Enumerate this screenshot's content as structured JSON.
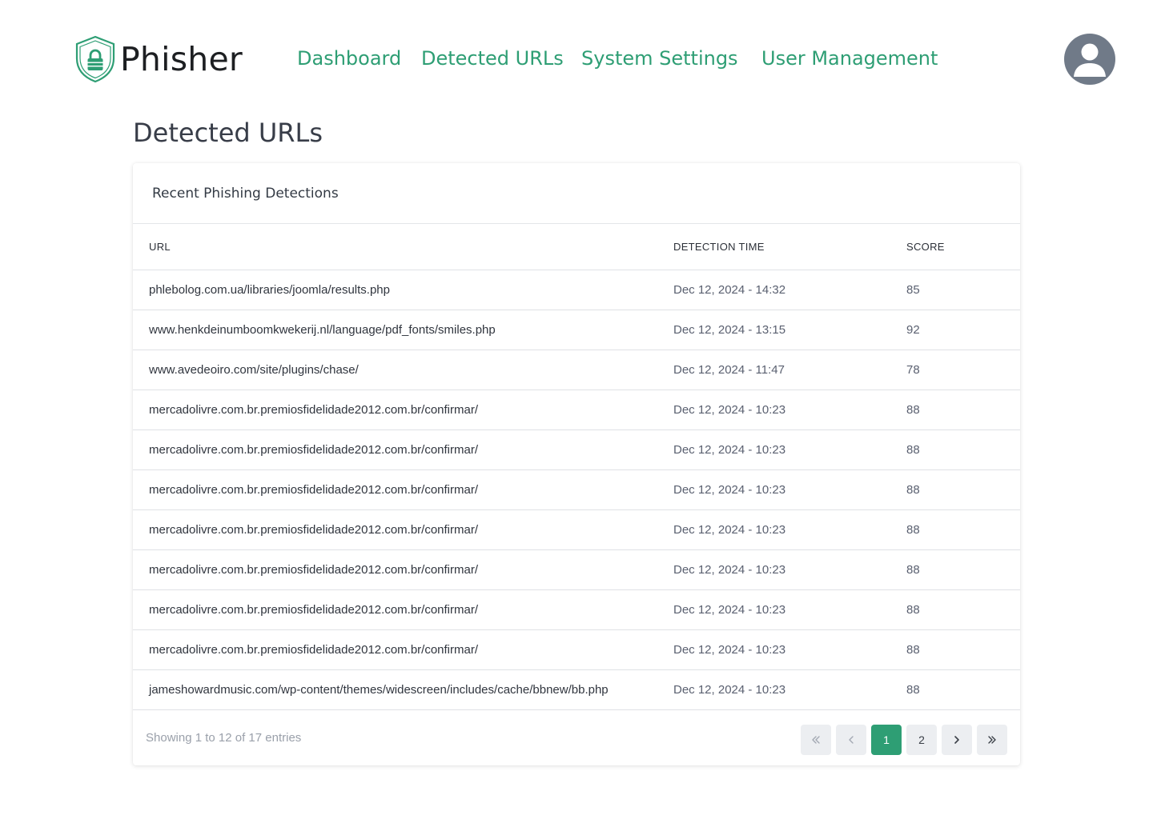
{
  "app": {
    "name": "Phisher",
    "brand_color": "#2e9e74"
  },
  "nav": {
    "items": [
      {
        "label": "Dashboard"
      },
      {
        "label": "Detected URLs"
      },
      {
        "label": "System Settings"
      },
      {
        "label": "User Management"
      }
    ]
  },
  "user": {
    "icon": "user-avatar-icon"
  },
  "page": {
    "title": "Detected URLs"
  },
  "card": {
    "title": "Recent Phishing Detections"
  },
  "table": {
    "columns": [
      "URL",
      "DETECTION TIME",
      "SCORE"
    ],
    "rows": [
      {
        "url": "phlebolog.com.ua/libraries/joomla/results.php",
        "time": "Dec 12, 2024 - 14:32",
        "score": "85"
      },
      {
        "url": "www.henkdeinumboomkwekerij.nl/language/pdf_fonts/smiles.php",
        "time": "Dec 12, 2024 - 13:15",
        "score": "92"
      },
      {
        "url": "www.avedeoiro.com/site/plugins/chase/",
        "time": "Dec 12, 2024 - 11:47",
        "score": "78"
      },
      {
        "url": "mercadolivre.com.br.premiosfidelidade2012.com.br/confirmar/",
        "time": "Dec 12, 2024 - 10:23",
        "score": "88"
      },
      {
        "url": "mercadolivre.com.br.premiosfidelidade2012.com.br/confirmar/",
        "time": "Dec 12, 2024 - 10:23",
        "score": "88"
      },
      {
        "url": "mercadolivre.com.br.premiosfidelidade2012.com.br/confirmar/",
        "time": "Dec 12, 2024 - 10:23",
        "score": "88"
      },
      {
        "url": "mercadolivre.com.br.premiosfidelidade2012.com.br/confirmar/",
        "time": "Dec 12, 2024 - 10:23",
        "score": "88"
      },
      {
        "url": "mercadolivre.com.br.premiosfidelidade2012.com.br/confirmar/",
        "time": "Dec 12, 2024 - 10:23",
        "score": "88"
      },
      {
        "url": "mercadolivre.com.br.premiosfidelidade2012.com.br/confirmar/",
        "time": "Dec 12, 2024 - 10:23",
        "score": "88"
      },
      {
        "url": "mercadolivre.com.br.premiosfidelidade2012.com.br/confirmar/",
        "time": "Dec 12, 2024 - 10:23",
        "score": "88"
      },
      {
        "url": "jameshowardmusic.com/wp-content/themes/widescreen/includes/cache/bbnew/bb.php",
        "time": "Dec 12, 2024 - 10:23",
        "score": "88"
      }
    ]
  },
  "footer": {
    "showing": "Showing 1 to 12 of 17 entries",
    "pagination": {
      "first_icon": "double-chevron-left-icon",
      "prev_icon": "chevron-left-icon",
      "pages": [
        "1",
        "2"
      ],
      "current_page": "1",
      "next_icon": "chevron-right-icon",
      "last_icon": "double-chevron-right-icon"
    }
  }
}
